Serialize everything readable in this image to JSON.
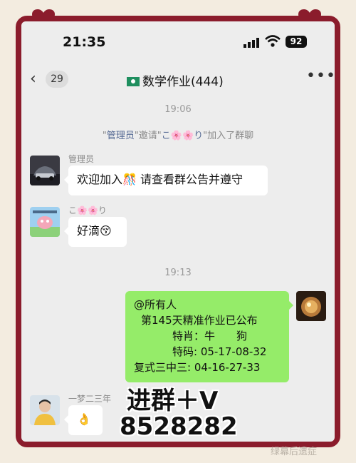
{
  "status_bar": {
    "time": "21:35",
    "battery": "92"
  },
  "nav": {
    "back_count": "29",
    "title": "数学作业(444)"
  },
  "timestamps": {
    "first": "19:06",
    "second": "19:13"
  },
  "system": {
    "q1": "\"",
    "admin": "管理员",
    "q2": "\"邀请\"",
    "invitee": "こ🌸🌸り",
    "tail": "\"加入了群聊"
  },
  "messages": [
    {
      "sender": "管理员",
      "text": "欢迎加入🎊 请查看群公告并遵守"
    },
    {
      "sender": "こ🌸🌸り",
      "text": "好滴😚"
    },
    {
      "lines": [
        "@所有人",
        "第145天精准作业已公布",
        "特肖：牛　　狗",
        "特码: 05-17-08-32",
        "复式三中三: 04-16-27-33"
      ]
    },
    {
      "sender": "一梦二三年",
      "text": "👌"
    }
  ],
  "overlay": {
    "line1": "进群＋V",
    "line2": "8528282"
  },
  "watermark": "绿幕后遗症",
  "colors": {
    "frame": "#8b1c2c",
    "bubble_green": "#95ec69",
    "background": "#f3ece0"
  }
}
